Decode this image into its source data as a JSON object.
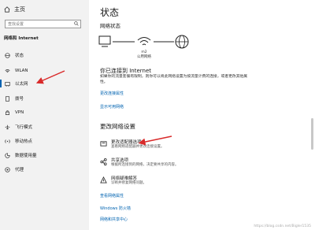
{
  "sidebar": {
    "home_label": "主页",
    "search_placeholder": "查找设置",
    "section_title": "网络和 Internet",
    "items": [
      {
        "label": "状态"
      },
      {
        "label": "WLAN"
      },
      {
        "label": "以太网"
      },
      {
        "label": "拨号"
      },
      {
        "label": "VPN"
      },
      {
        "label": "飞行模式"
      },
      {
        "label": "移动热点"
      },
      {
        "label": "数据使用量"
      },
      {
        "label": "代理"
      }
    ]
  },
  "main": {
    "title": "状态",
    "network_status_label": "网络状态",
    "network_name": "m2",
    "network_type": "公用网络",
    "connected_title": "你已连接到 Internet",
    "connected_desc": "如果你的流量套餐有限制，则你可以将此网络设置为按流量计费的连接，或者更改其他属性。",
    "link_change_props": "更改连接属性",
    "link_show_networks": "显示可用网络",
    "change_settings_title": "更改网络设置",
    "options": [
      {
        "title": "更改适配器选项",
        "desc": "查看网络适配器并更改连接设置。"
      },
      {
        "title": "共享选项",
        "desc": "根据所连接到的网络，决定要共享的内容。"
      },
      {
        "title": "网络疑难解答",
        "desc": "诊断并修复网络问题。"
      }
    ],
    "bottom_links": [
      "查看网络属性",
      "Windows 防火墙",
      "网络和共享中心"
    ],
    "watermark": "https://blog.csdn.net/Bigler1535"
  },
  "colors": {
    "accent": "#0063b1",
    "arrow": "#d92a2a",
    "sidebar_bg": "#f2f2f2"
  }
}
